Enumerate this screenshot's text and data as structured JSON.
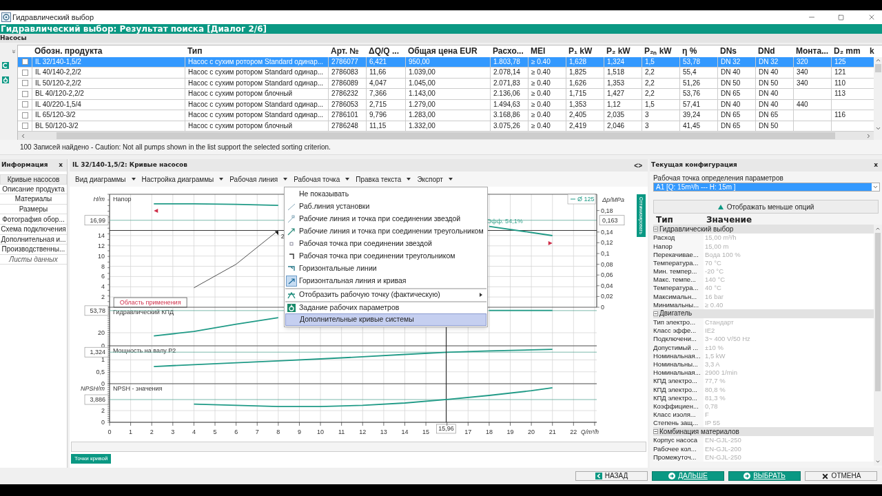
{
  "window": {
    "title": "Гидравлический выбор"
  },
  "header": "Гидравлический выбор: Результат поиска [Диалог 2/6]",
  "pumps": {
    "title": "Насосы",
    "columns": [
      "Обозн. продукта",
      "Тип",
      "Арт. №",
      "ΔQ/Q ...",
      "Общая цена EUR",
      "Расхо...",
      "MEI",
      "P₁ kW",
      "P₂ kW",
      "P₂ₙ kW",
      "η %",
      "DNs",
      "DNd",
      "Монта...",
      "D₂ mm",
      "k"
    ],
    "rows": [
      {
        "selected": true,
        "checked": false,
        "cells": [
          "IL 32/140-1,5/2",
          "Насос с сухим ротором Standard одинар...",
          "2786077",
          "6,421",
          "950,00",
          "1.803,78",
          "≥ 0.40",
          "1,628",
          "1,324",
          "1,5",
          "53,78",
          "DN 32",
          "DN 32",
          "320",
          "125"
        ]
      },
      {
        "selected": false,
        "checked": false,
        "cells": [
          "IL 40/140-2,2/2",
          "Насос с сухим ротором Standard одинар...",
          "2786083",
          "11,66",
          "1.039,00",
          "2.078,14",
          "≥ 0.40",
          "1,825",
          "1,518",
          "2,2",
          "55,4",
          "DN 40",
          "DN 40",
          "340",
          "121"
        ]
      },
      {
        "selected": false,
        "checked": false,
        "cells": [
          "IL 50/120-2,2/2",
          "Насос с сухим ротором Standard одинар...",
          "2786089",
          "4,047",
          "1.045,00",
          "2.071,83",
          "≥ 0.40",
          "1,626",
          "1,353",
          "2,2",
          "51,26",
          "DN 50",
          "DN 50",
          "340",
          "110"
        ]
      },
      {
        "selected": false,
        "checked": false,
        "cells": [
          "BL 40/120-2,2/2",
          "Насос с сухим ротором блочный",
          "2786232",
          "7,366",
          "1.143,00",
          "2.136,06",
          "≥ 0.40",
          "1,715",
          "1,427",
          "2,2",
          "53,76",
          "DN 65",
          "DN 40",
          null,
          "113"
        ]
      },
      {
        "selected": false,
        "checked": false,
        "cells": [
          "IL 40/220-1,5/4",
          "Насос с сухим ротором Standard одинар...",
          "2786053",
          "2,715",
          "1.279,00",
          "1.494,63",
          "≥ 0.40",
          "1,353",
          "1,12",
          "1,5",
          "57,41",
          "DN 40",
          "DN 40",
          "440",
          null
        ]
      },
      {
        "selected": false,
        "checked": false,
        "cells": [
          "IL 65/120-3/2",
          "Насос с сухим ротором Standard одинар...",
          "2786101",
          "9,796",
          "1.283,00",
          "3.168,86",
          "≥ 0.40",
          "2,405",
          "2,035",
          "3",
          "39,24",
          "DN 65",
          "DN 65",
          null,
          "116"
        ]
      },
      {
        "selected": false,
        "checked": false,
        "cells": [
          "BL 50/120-3/2",
          "Насос с сухим ротором блочный",
          "2786248",
          "11,15",
          "1.332,00",
          "3.075,26",
          "≥ 0.40",
          "2,419",
          "2,046",
          "3",
          "41,45",
          "DN 65",
          "DN 50",
          null,
          null
        ]
      }
    ],
    "status": "100 Записей найдено - Caution: Not all pumps shown in the list support the selected sorting criterion."
  },
  "info": {
    "title": "Информация",
    "close": "x",
    "items": [
      {
        "label": "Кривые насосов",
        "selected": true,
        "disabled": false
      },
      {
        "label": "Описание продукта",
        "selected": false,
        "disabled": false
      },
      {
        "label": "Материалы",
        "selected": false,
        "disabled": false
      },
      {
        "label": "Размеры",
        "selected": false,
        "disabled": false
      },
      {
        "label": "Фотография обор...",
        "selected": false,
        "disabled": false
      },
      {
        "label": "Схема подключения",
        "selected": false,
        "disabled": false
      },
      {
        "label": "Дополнительная и...",
        "selected": false,
        "disabled": false
      },
      {
        "label": "Производственны...",
        "selected": false,
        "disabled": false
      },
      {
        "label": "Листы данных",
        "selected": false,
        "disabled": true
      }
    ]
  },
  "curves": {
    "title": "IL 32/140-1,5/2: Кривые насосов",
    "toggle": "<>",
    "menus": [
      "Вид диаграммы",
      "Настройка диаграммы",
      "Рабочая линия",
      "Рабочая точка",
      "Правка текста",
      "Экспорт"
    ],
    "context_menu": [
      {
        "label": "Не показывать",
        "checked": false,
        "selected": false,
        "separator_before": false,
        "submenu": false
      },
      {
        "label": "Раб.линия установки",
        "checked": false,
        "selected": false,
        "separator_before": false,
        "submenu": false
      },
      {
        "label": "Рабочие линия и точка при соединении звездой",
        "checked": false,
        "selected": false,
        "separator_before": false,
        "submenu": false
      },
      {
        "label": "Рабочие линия и точка при соединении треугольником",
        "checked": false,
        "selected": false,
        "separator_before": false,
        "submenu": false
      },
      {
        "label": "Рабочая точка при соединении звездой",
        "checked": false,
        "selected": false,
        "separator_before": false,
        "submenu": false
      },
      {
        "label": "Рабочая точка при соединении треугольником",
        "checked": false,
        "selected": false,
        "separator_before": false,
        "submenu": false
      },
      {
        "label": "Горизонтальные линии",
        "checked": false,
        "selected": false,
        "separator_before": false,
        "submenu": false
      },
      {
        "label": "Горизонтальная линия и кривая",
        "checked": true,
        "selected": false,
        "separator_before": false,
        "submenu": false
      },
      {
        "label": "Отобразить рабочую точку (фактическую)",
        "checked": false,
        "selected": false,
        "separator_before": true,
        "submenu": true
      },
      {
        "label": "Задание рабочих параметров",
        "checked": false,
        "selected": false,
        "separator_before": true,
        "submenu": false
      },
      {
        "label": "Дополнительные кривые системы",
        "checked": false,
        "selected": true,
        "separator_before": false,
        "submenu": false
      }
    ],
    "plots": [
      {
        "chart_data": {
          "type": "line",
          "title": "Напор",
          "ylabel": "H/m",
          "grid": true,
          "x": [
            2.1,
            4,
            6,
            8,
            10,
            12,
            14,
            16,
            18,
            20,
            21
          ],
          "xlim": [
            0,
            23.1
          ],
          "ylim": [
            0,
            22.07
          ],
          "yticks": [
            2,
            4,
            6,
            8,
            10,
            12,
            14
          ],
          "series": [
            {
              "name": "Ø 125",
              "color": "#1f9a86",
              "values": [
                20.2,
                20.2,
                20.1,
                19.9,
                null,
                null,
                null,
                null,
                15.8,
                14.6,
                14
              ]
            },
            {
              "color": "#222222",
              "values": [
                null,
                3.8,
                8.4,
                15,
                null,
                null,
                null,
                null,
                null,
                null,
                null
              ]
            }
          ],
          "ref_lines": [
            {
              "axis": "y",
              "value": 16.99,
              "label": "16,99"
            },
            {
              "axis": "y",
              "value": 15
            }
          ],
          "annotations": [
            {
              "x": 8,
              "y": 15,
              "text": "2"
            },
            "Эфф. 54,1%",
            "Область применения"
          ]
        },
        "right_axis": {
          "label": "Δp/MPa",
          "ticks": [
            "0,18",
            "0,14",
            "0,12",
            "0,1",
            "0,08",
            "0,06",
            "0,04",
            "0,02",
            "0"
          ],
          "reading": "0,163"
        }
      },
      {
        "chart_data": {
          "type": "line",
          "title": "Гидравлический КПД",
          "grid": true,
          "x": [
            2.1,
            4,
            6,
            8,
            10,
            12,
            14,
            16,
            18,
            20,
            21
          ],
          "xlim": [
            0,
            23.1
          ],
          "ylim": [
            0,
            58.9
          ],
          "yticks": [
            0,
            20
          ],
          "series": [
            {
              "color": "#1f9a86",
              "values": [
                15,
                22,
                33,
                43,
                null,
                null,
                null,
                null,
                54,
                54,
                54
              ]
            }
          ],
          "ref_lines": [
            {
              "axis": "y",
              "value": 53.78,
              "label": "53,78"
            }
          ]
        }
      },
      {
        "chart_data": {
          "type": "line",
          "title": "Мощность на валу P2",
          "grid": true,
          "x": [
            2.1,
            4,
            6,
            8,
            10,
            12,
            14,
            16,
            18,
            20,
            21
          ],
          "xlim": [
            0,
            23.1
          ],
          "ylim": [
            0,
            1.59
          ],
          "yticks": [
            0,
            {
              "value": 0.5,
              "label": "0,5"
            },
            1
          ],
          "series": [
            {
              "color": "#1f9a86",
              "values": [
                0.72,
                0.8,
                0.88,
                0.96,
                1.04,
                1.13,
                1.23,
                1.32,
                1.38,
                1.42,
                1.44
              ]
            }
          ],
          "ref_lines": [
            {
              "axis": "y",
              "value": 1.324,
              "label": "1,324"
            }
          ]
        }
      },
      {
        "chart_data": {
          "type": "line",
          "title": "NPSH - значения",
          "ylabel": "NPSH/m",
          "xlabel": "Q/m³/h",
          "grid": true,
          "x": [
            4,
            6,
            8,
            10,
            12,
            14,
            16,
            18,
            20,
            21
          ],
          "xlim": [
            0,
            23.1
          ],
          "ylim": [
            0,
            6.6
          ],
          "yticks": [
            0,
            2
          ],
          "xticks": [
            0,
            1,
            2,
            3,
            4,
            5,
            6,
            7,
            8,
            9,
            10,
            11,
            12,
            13,
            14,
            15,
            17,
            18,
            19,
            20,
            21,
            22
          ],
          "series": [
            {
              "color": "#1f9a86",
              "values": [
                3.1,
                2.9,
                2.7,
                2.7,
                2.9,
                3.3,
                3.9,
                4.6,
                5.4,
                5.9
              ]
            }
          ],
          "ref_lines": [
            {
              "axis": "y",
              "value": 3.886,
              "label": "3,886"
            },
            {
              "axis": "x",
              "value": 15.96,
              "label": "15,96"
            }
          ]
        }
      }
    ],
    "side_tab": "Оптимизировать",
    "curve_points_button": "Точки кривой"
  },
  "config": {
    "title": "Текущая конфигурация",
    "close": "x",
    "point_label": "Рабочая точка определения параметров",
    "point_value": "A1 [Q: 15m³/h --- H: 15m ]",
    "toggle_button": "Отображать меньше опций",
    "columns": [
      "Тип",
      "Значение"
    ],
    "groups": [
      {
        "title": "Гидравлический выбор",
        "expanded": true,
        "rows": [
          {
            "name": "Расход",
            "value": "15,00 m³/h"
          },
          {
            "name": "Напор",
            "value": "15,00 m"
          },
          {
            "name": "Перекачивае...",
            "value": "Вода 100 %"
          },
          {
            "name": "Температура...",
            "value": "70 °C"
          },
          {
            "name": "Мин. темпер...",
            "value": "-20 °C"
          },
          {
            "name": "Макс. темпе...",
            "value": "140 °C"
          },
          {
            "name": "Температура...",
            "value": "40 °C"
          },
          {
            "name": "Максимальн...",
            "value": "16 bar"
          },
          {
            "name": "Минимальны...",
            "value": "≥ 0.40"
          }
        ]
      },
      {
        "title": "Двигатель",
        "expanded": true,
        "rows": [
          {
            "name": "Тип электро...",
            "value": "Стандарт"
          },
          {
            "name": "Класс эффе...",
            "value": "IE2"
          },
          {
            "name": "Подключени...",
            "value": "3~ 400 V/50 Hz"
          },
          {
            "name": "Допустимый ...",
            "value": "±10 %"
          },
          {
            "name": "Номинальная...",
            "value": "1,5 kW"
          },
          {
            "name": "Номинальны...",
            "value": "3,3 A"
          },
          {
            "name": "Номинальная...",
            "value": "2900 1/min"
          },
          {
            "name": "КПД электро...",
            "value": "77,7 %"
          },
          {
            "name": "КПД электро...",
            "value": "80,8 %"
          },
          {
            "name": "КПД электро...",
            "value": "81,3 %"
          },
          {
            "name": "Коэффициен...",
            "value": "0,78"
          },
          {
            "name": "Класс изоля...",
            "value": "F"
          },
          {
            "name": "Степень защ...",
            "value": "IP 55"
          }
        ]
      },
      {
        "title": "Комбинация материалов",
        "expanded": true,
        "rows": [
          {
            "name": "Корпус насоса",
            "value": "EN-GJL-250"
          },
          {
            "name": "Рабочее кол...",
            "value": "EN-GJL-200"
          },
          {
            "name": "Промежуточ...",
            "value": "EN-GJL-250"
          }
        ]
      }
    ]
  },
  "footer": [
    {
      "label": "НАЗАД",
      "kind": "back"
    },
    {
      "label": "ДАЛЬШЕ",
      "kind": "next"
    },
    {
      "label": "ВЫБРАТЬ",
      "kind": "select"
    },
    {
      "label": "ОТМЕНА",
      "kind": "cancel"
    }
  ]
}
